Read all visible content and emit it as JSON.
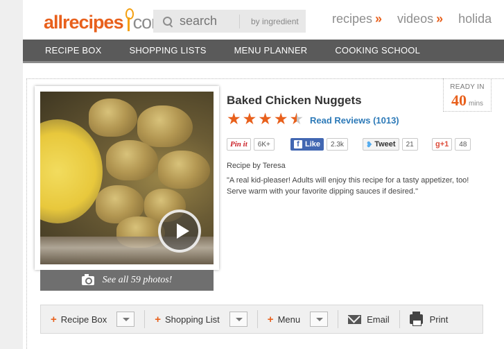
{
  "header": {
    "logo_text_left": "allrecipes",
    "logo_text_right": "com",
    "logo_trademark": "®",
    "search_placeholder": "search",
    "search_by_ingredient": "by ingredient",
    "top_nav": [
      {
        "label": "recipes",
        "arrow": "»"
      },
      {
        "label": "videos",
        "arrow": "»"
      },
      {
        "label": "holida",
        "arrow": ""
      }
    ]
  },
  "navbar": {
    "items": [
      "RECIPE BOX",
      "SHOPPING LISTS",
      "MENU PLANNER",
      "COOKING SCHOOL"
    ]
  },
  "recipe": {
    "title": "Baked Chicken Nuggets",
    "rating_value": 4.5,
    "rating_max": 5,
    "reviews_label": "Read Reviews",
    "reviews_count": "(1013)",
    "ready_label": "READY IN",
    "ready_minutes": "40",
    "ready_unit": "mins",
    "byline": "Recipe by Teresa",
    "description": "\"A real kid-pleaser! Adults will enjoy this recipe for a tasty appetizer, too! Serve warm with your favorite dipping sauces if desired.\""
  },
  "social": {
    "pinterest_label": "Pin it",
    "pinterest_count": "6K+",
    "facebook_label": "Like",
    "facebook_count": "2.3k",
    "twitter_label": "Tweet",
    "twitter_count": "21",
    "gplus_label": "g+1",
    "gplus_count": "48"
  },
  "photo": {
    "see_photos_label": "See all 59 photos!"
  },
  "actions": {
    "recipe_box": "Recipe Box",
    "shopping_list": "Shopping List",
    "menu": "Menu",
    "email": "Email",
    "print": "Print"
  },
  "colors": {
    "accent": "#e8601c",
    "link": "#2d7ab8",
    "navbar": "#5a5a5a"
  }
}
